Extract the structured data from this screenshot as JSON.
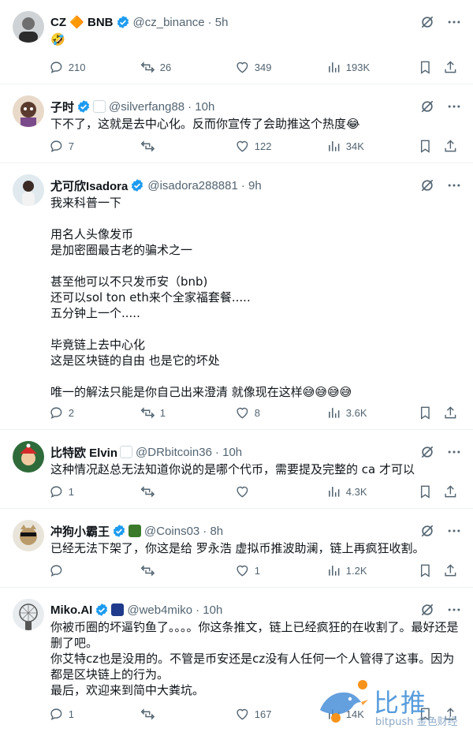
{
  "tweets": [
    {
      "name": "CZ 🔶 BNB",
      "handle": "@cz_binance",
      "time": "· 5h",
      "text": "🤣",
      "replies": "210",
      "retweets": "26",
      "likes": "349",
      "views": "193K",
      "avatar_icon": "user-avatar"
    },
    {
      "name": "子时",
      "handle": "@silverfang88",
      "time": "· 10h",
      "text": "下不了，这就是去中心化。反而你宣传了会助推这个热度😂",
      "replies": "7",
      "retweets": "",
      "likes": "122",
      "views": "34K",
      "avatar_icon": "user-avatar"
    },
    {
      "name": "尤可欣Isadora",
      "handle": "@isadora288881",
      "time": "· 9h",
      "text": "我来科普一下\n\n用名人头像发币\n是加密圈最古老的骗术之一\n\n甚至他可以不只发币安（bnb)\n还可以sol ton eth来个全家福套餐.....\n五分钟上一个.....\n\n毕竟链上去中心化\n这是区块链的自由 也是它的坏处\n\n唯一的解法只能是你自己出来澄清 就像现在这样😅😅😅😅",
      "replies": "2",
      "retweets": "1",
      "likes": "8",
      "views": "3.6K",
      "avatar_icon": "user-avatar"
    },
    {
      "name": "比特欧 Elvin",
      "handle": "@DRbitcoin36",
      "time": "· 10h",
      "text": "这种情况赵总无法知道你说的是哪个代币，需要提及完整的 ca 才可以",
      "replies": "1",
      "retweets": "",
      "likes": "",
      "views": "4.3K",
      "avatar_icon": "user-avatar"
    },
    {
      "name": "冲狗小霸王",
      "handle": "@Coins03",
      "time": "· 8h",
      "text": "已经无法下架了，你这是给 罗永浩 虚拟币推波助澜，链上再疯狂收割。",
      "replies": "",
      "retweets": "",
      "likes": "1",
      "views": "1.2K",
      "avatar_icon": "user-avatar"
    },
    {
      "name": "Miko.AI",
      "handle": "@web4miko",
      "time": "· 10h",
      "text": "你被币圈的坏逼钓鱼了。。。。你这条推文，链上已经疯狂的在收割了。最好还是删了吧。\n你艾特cz也是没用的。不管是币安还是cz没有人任何一个人管得了这事。因为都是区块链上的行为。\n最后，欢迎来到简中大粪坑。",
      "replies": "1",
      "retweets": "",
      "likes": "167",
      "views": "14K",
      "avatar_icon": "user-avatar"
    }
  ],
  "watermark": {
    "title": "比推",
    "subtitle": "bitpush 金色财经"
  },
  "colors": {
    "verified": "#1d9bf0",
    "muted": "#536471",
    "divider": "#eff3f4"
  }
}
